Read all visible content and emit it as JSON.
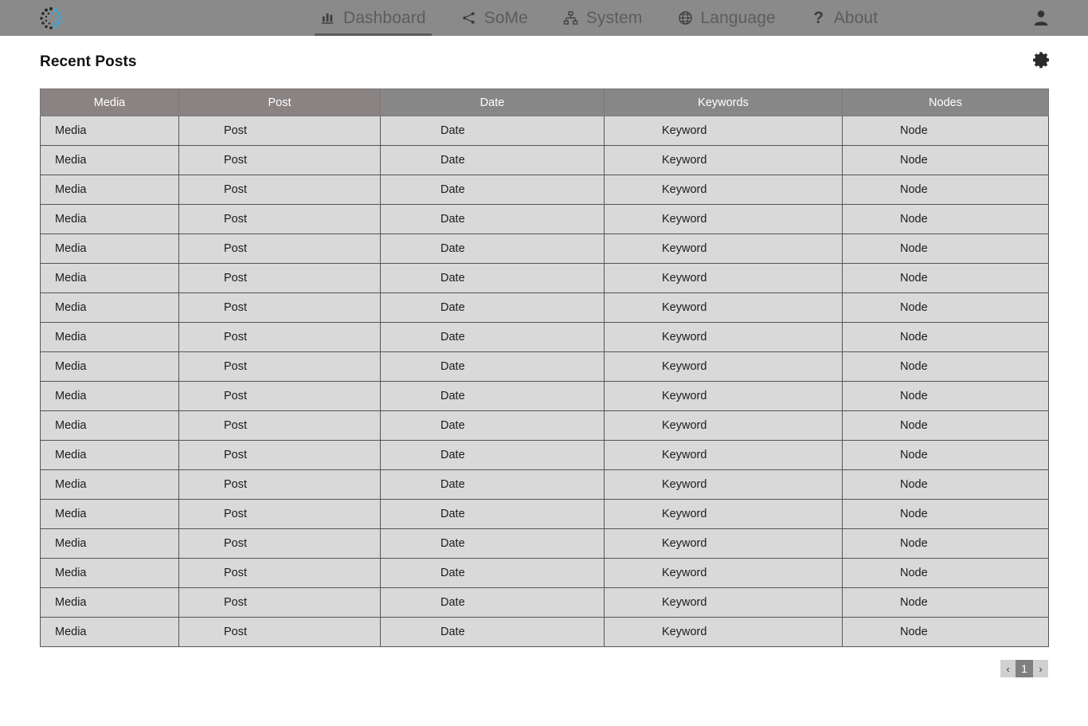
{
  "nav": {
    "logo_name": "spinner-dots-logo",
    "items": [
      {
        "id": "dashboard",
        "label": "Dashboard",
        "icon": "bar-chart-icon",
        "active": true
      },
      {
        "id": "some",
        "label": "SoMe",
        "icon": "share-icon",
        "active": false
      },
      {
        "id": "system",
        "label": "System",
        "icon": "sitemap-icon",
        "active": false
      },
      {
        "id": "language",
        "label": "Language",
        "icon": "globe-icon",
        "active": false
      },
      {
        "id": "about",
        "label": "About",
        "icon": "question-mark-icon",
        "active": false
      }
    ],
    "user_icon": "user-account-icon"
  },
  "page": {
    "title": "Recent Posts",
    "settings_icon": "gear-icon"
  },
  "table": {
    "columns": [
      "Media",
      "Post",
      "Date",
      "Keywords",
      "Nodes"
    ],
    "rows": [
      [
        "Media",
        "Post",
        "Date",
        "Keyword",
        "Node"
      ],
      [
        "Media",
        "Post",
        "Date",
        "Keyword",
        "Node"
      ],
      [
        "Media",
        "Post",
        "Date",
        "Keyword",
        "Node"
      ],
      [
        "Media",
        "Post",
        "Date",
        "Keyword",
        "Node"
      ],
      [
        "Media",
        "Post",
        "Date",
        "Keyword",
        "Node"
      ],
      [
        "Media",
        "Post",
        "Date",
        "Keyword",
        "Node"
      ],
      [
        "Media",
        "Post",
        "Date",
        "Keyword",
        "Node"
      ],
      [
        "Media",
        "Post",
        "Date",
        "Keyword",
        "Node"
      ],
      [
        "Media",
        "Post",
        "Date",
        "Keyword",
        "Node"
      ],
      [
        "Media",
        "Post",
        "Date",
        "Keyword",
        "Node"
      ],
      [
        "Media",
        "Post",
        "Date",
        "Keyword",
        "Node"
      ],
      [
        "Media",
        "Post",
        "Date",
        "Keyword",
        "Node"
      ],
      [
        "Media",
        "Post",
        "Date",
        "Keyword",
        "Node"
      ],
      [
        "Media",
        "Post",
        "Date",
        "Keyword",
        "Node"
      ],
      [
        "Media",
        "Post",
        "Date",
        "Keyword",
        "Node"
      ],
      [
        "Media",
        "Post",
        "Date",
        "Keyword",
        "Node"
      ],
      [
        "Media",
        "Post",
        "Date",
        "Keyword",
        "Node"
      ],
      [
        "Media",
        "Post",
        "Date",
        "Keyword",
        "Node"
      ]
    ]
  },
  "pagination": {
    "prev_label": "‹",
    "next_label": "›",
    "current_page": "1"
  },
  "colors": {
    "navbar_bg": "#8a8a8a",
    "header_row_bg": "#8a8383",
    "row_bg": "#d9d9d9",
    "active_page_bg": "#808080",
    "logo_accent": "#33aadd"
  }
}
